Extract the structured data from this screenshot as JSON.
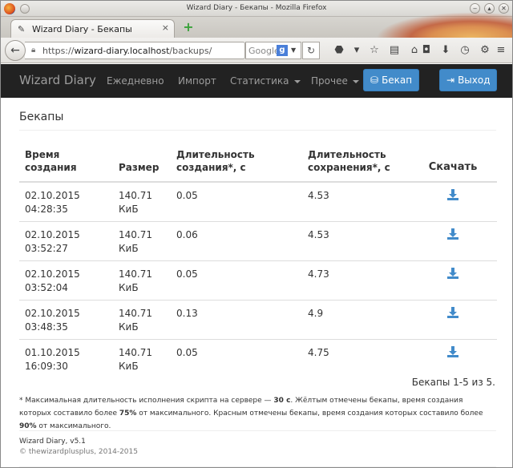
{
  "browser": {
    "window_title": "Wizard Diary - Бекапы - Mozilla Firefox",
    "tab_label": "Wizard Diary - Бекапы",
    "url_scheme": "https://",
    "url_host": "wizard-diary.localhost",
    "url_path": "/backups/",
    "search_engine": "Google",
    "search_icon_letter": "g",
    "tab_close": "×",
    "new_tab": "+"
  },
  "site": {
    "brand": "Wizard Diary",
    "nav": [
      {
        "label": "Ежедневно"
      },
      {
        "label": "Импорт"
      },
      {
        "label": "Статистика"
      },
      {
        "label": "Прочее"
      }
    ],
    "backup_button": "Бекап",
    "logout_button": "Выход",
    "accent_color": "#428bca",
    "navbar_color": "#222222"
  },
  "page": {
    "title": "Бекапы",
    "columns": {
      "created": "Время создания",
      "size": "Размер",
      "create_duration": "Длительность создания*, с",
      "save_duration": "Длительность сохранения*, с",
      "download": "Скачать"
    },
    "rows": [
      {
        "date": "02.10.2015",
        "time": "04:28:35",
        "size": "140.71",
        "unit": "КиБ",
        "create": "0.05",
        "save": "4.53"
      },
      {
        "date": "02.10.2015",
        "time": "03:52:27",
        "size": "140.71",
        "unit": "КиБ",
        "create": "0.06",
        "save": "4.53"
      },
      {
        "date": "02.10.2015",
        "time": "03:52:04",
        "size": "140.71",
        "unit": "КиБ",
        "create": "0.05",
        "save": "4.73"
      },
      {
        "date": "02.10.2015",
        "time": "03:48:35",
        "size": "140.71",
        "unit": "КиБ",
        "create": "0.13",
        "save": "4.9"
      },
      {
        "date": "01.10.2015",
        "time": "16:09:30",
        "size": "140.71",
        "unit": "КиБ",
        "create": "0.05",
        "save": "4.75"
      }
    ],
    "pager": "Бекапы 1-5 из 5.",
    "footnote": {
      "p1": "* Максимальная длительность исполнения скрипта на сервере — ",
      "b1": "30 с",
      "p2": ". Жёлтым отмечены бекапы, время создания которых составило более ",
      "b2": "75%",
      "p3": " от максимального. Красным отмечены бекапы, время создания которых составило более ",
      "b3": "90%",
      "p4": " от максимального."
    },
    "footer_name": "Wizard Diary, v5.1",
    "footer_copy": "© thewizardplusplus, 2014-2015"
  }
}
